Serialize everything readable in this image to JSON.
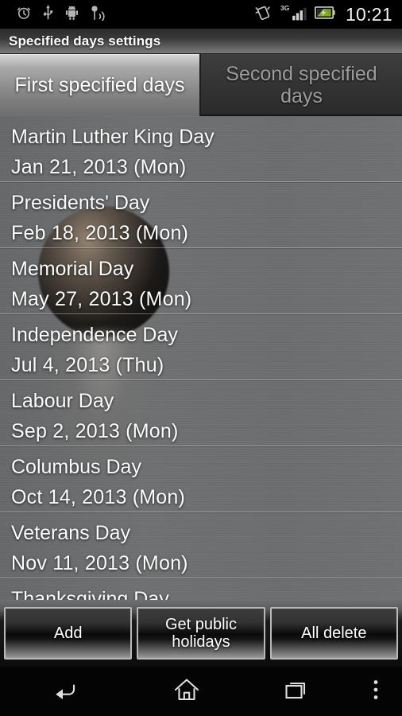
{
  "status_bar": {
    "icons_left": [
      "alarm-clock-icon",
      "usb-icon",
      "android-robot-icon",
      "wifi-tether-icon"
    ],
    "icons_right": [
      "vibrate-icon",
      "signal-3g-icon",
      "battery-charging-icon"
    ],
    "network_label": "3G",
    "time": "10:21"
  },
  "title_bar": {
    "title": "Specified days settings"
  },
  "tabs": [
    {
      "label": "First specified days",
      "active": true
    },
    {
      "label": "Second specified days",
      "active": false
    }
  ],
  "list": {
    "items": [
      {
        "name": "Martin Luther King Day",
        "date": "Jan 21, 2013 (Mon)"
      },
      {
        "name": "Presidents' Day",
        "date": "Feb 18, 2013 (Mon)"
      },
      {
        "name": "Memorial Day",
        "date": "May 27, 2013 (Mon)"
      },
      {
        "name": "Independence Day",
        "date": "Jul 4, 2013 (Thu)"
      },
      {
        "name": "Labour Day",
        "date": "Sep 2, 2013 (Mon)"
      },
      {
        "name": "Columbus Day",
        "date": "Oct 14, 2013 (Mon)"
      },
      {
        "name": "Veterans Day",
        "date": "Nov 11, 2013 (Mon)"
      },
      {
        "name": "Thanksgiving Day",
        "date": ""
      }
    ]
  },
  "buttons": [
    {
      "label": "Add"
    },
    {
      "label": "Get public holidays"
    },
    {
      "label": "All delete"
    }
  ],
  "nav_bar": {
    "back": "back-icon",
    "home": "home-icon",
    "recents": "recent-apps-icon",
    "menu": "overflow-menu-icon"
  },
  "colors": {
    "list_background": "#6e7070",
    "title_bar_dark": "#2b2b2b",
    "active_tab_light": "#d8d8d8",
    "text_primary": "#fcfcfc",
    "battery_green": "#8fc31f"
  }
}
